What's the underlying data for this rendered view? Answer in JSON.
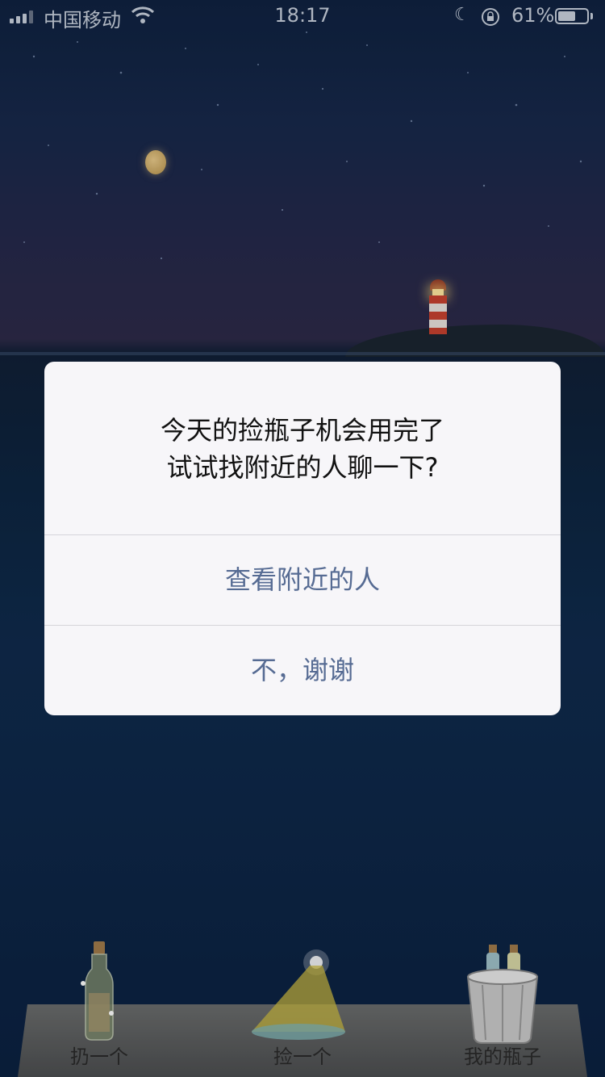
{
  "status_bar": {
    "carrier": "中国移动",
    "time": "18:17",
    "battery_percent_label": "61%",
    "battery_level": 0.61
  },
  "dialog": {
    "message_line1": "今天的捡瓶子机会用完了",
    "message_line2": "试试找附近的人聊一下?",
    "primary_button": "查看附近的人",
    "secondary_button": "不，谢谢"
  },
  "bottom_bar": {
    "items": [
      {
        "label": "扔一个",
        "icon": "bottle-icon"
      },
      {
        "label": "捡一个",
        "icon": "net-light-icon"
      },
      {
        "label": "我的瓶子",
        "icon": "bucket-icon"
      }
    ]
  },
  "colors": {
    "dialog_button_text": "#566b93",
    "dialog_background": "#f7f6f9",
    "night_sky": "#17284a"
  }
}
